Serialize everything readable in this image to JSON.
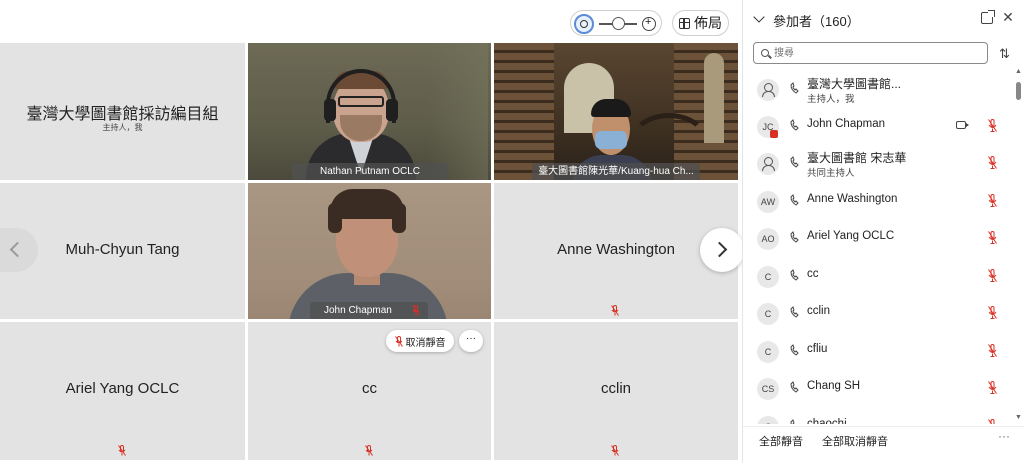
{
  "toolbar": {
    "layout_label": "佈局"
  },
  "tiles": {
    "t1": {
      "name": "臺灣大學圖書館採訪編目組",
      "sub": "主持人，我"
    },
    "t2": {
      "caption": "Nathan Putnam OCLC"
    },
    "t3": {
      "caption": "臺大圖書館陳光華/Kuang-hua Ch..."
    },
    "t4": {
      "name": "Muh-Chyun Tang"
    },
    "t5": {
      "caption": "John Chapman"
    },
    "t6": {
      "name": "Anne Washington"
    },
    "t7": {
      "name": "Ariel Yang OCLC"
    },
    "t8": {
      "name": "cc"
    },
    "t9": {
      "name": "cclin"
    }
  },
  "tile_actions": {
    "unmute_label": "取消靜音",
    "more_label": "···"
  },
  "panel": {
    "title": "參加者（160）",
    "search_placeholder": "搜尋",
    "participants": [
      {
        "avatar": "",
        "name": "臺灣大學圖書館...",
        "role": "主持人，我"
      },
      {
        "avatar": "JC",
        "name": "John Chapman",
        "role": ""
      },
      {
        "avatar": "",
        "name": "臺大圖書館 宋志華",
        "role": "共同主持人"
      },
      {
        "avatar": "AW",
        "name": "Anne Washington",
        "role": ""
      },
      {
        "avatar": "AO",
        "name": "Ariel Yang OCLC",
        "role": ""
      },
      {
        "avatar": "C",
        "name": "cc",
        "role": ""
      },
      {
        "avatar": "C",
        "name": "cclin",
        "role": ""
      },
      {
        "avatar": "C",
        "name": "cfliu",
        "role": ""
      },
      {
        "avatar": "CS",
        "name": "Chang SH",
        "role": ""
      },
      {
        "avatar": "C",
        "name": "chaochi",
        "role": ""
      }
    ],
    "mute_all": "全部靜音",
    "unmute_all": "全部取消靜音",
    "more": "···"
  },
  "colors": {
    "muted_red": "#d93025",
    "tile_bg": "#e3e3e3",
    "accent": "#5b8bd8"
  }
}
